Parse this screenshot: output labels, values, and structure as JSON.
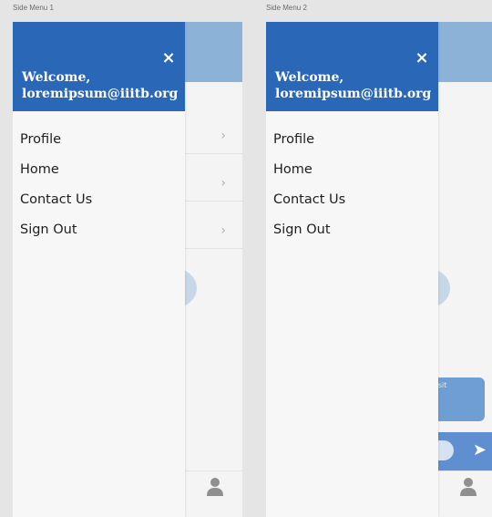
{
  "frames": [
    {
      "label": "Side Menu 1",
      "drawer": {
        "close_icon": "×",
        "welcome": "Welcome,",
        "email": "loremipsum@iiitb.org",
        "menu": [
          "Profile",
          "Home",
          "Contact Us",
          "Sign Out"
        ]
      },
      "background": {
        "chevron": "›",
        "bubble_text": ""
      }
    },
    {
      "label": "Side Menu 2",
      "drawer": {
        "close_icon": "×",
        "welcome": "Welcome,",
        "email": "loremipsum@iiitb.org",
        "menu": [
          "Profile",
          "Home",
          "Contact Us",
          "Sign Out"
        ]
      },
      "background": {
        "chevron": "",
        "bubble_text": "r sit",
        "send_icon": "➤"
      }
    }
  ],
  "colors": {
    "drawer_header": "#2a67b6",
    "app_header_dimmed": "#8cb3d7",
    "chat_bar": "#5f8fd0"
  }
}
